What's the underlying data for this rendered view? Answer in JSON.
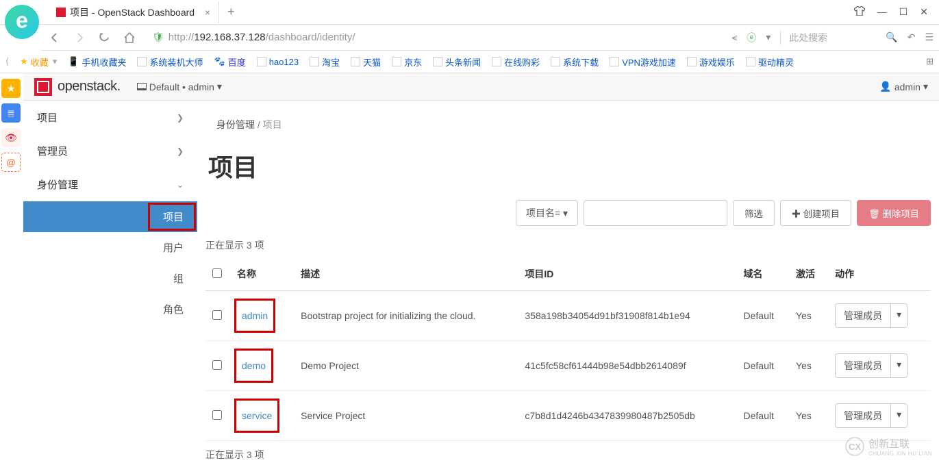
{
  "browser": {
    "tab_title": "项目 - OpenStack Dashboard",
    "url_proto": "http://",
    "url_host": "192.168.37.128",
    "url_path": "/dashboard/identity/",
    "search_placeholder": "此处搜索"
  },
  "bookmarks": {
    "fav": "收藏",
    "mobile": "手机收藏夹",
    "items": [
      "系统装机大师",
      "百度",
      "hao123",
      "淘宝",
      "天猫",
      "京东",
      "头条新闻",
      "在线购彩",
      "系统下载",
      "VPN游戏加速",
      "游戏娱乐",
      "驱动精灵"
    ]
  },
  "openstack": {
    "logo": "openstack.",
    "context": "Default • admin",
    "user": "admin"
  },
  "sidebar": {
    "items": [
      {
        "label": "项目",
        "expanded": false
      },
      {
        "label": "管理员",
        "expanded": false
      },
      {
        "label": "身份管理",
        "expanded": true
      }
    ],
    "subitems": [
      "项目",
      "用户",
      "组",
      "角色"
    ]
  },
  "breadcrumb": {
    "parent": "身份管理",
    "current": "项目"
  },
  "page": {
    "title": "项目"
  },
  "toolbar": {
    "filter_label": "项目名=",
    "filter_btn": "筛选",
    "create_btn": "创建项目",
    "delete_btn": "删除项目"
  },
  "table": {
    "count_text": "正在显示 3 项",
    "headers": {
      "name": "名称",
      "desc": "描述",
      "id": "项目ID",
      "domain": "域名",
      "active": "激活",
      "action": "动作"
    },
    "rows": [
      {
        "name": "admin",
        "desc": "Bootstrap project for initializing the cloud.",
        "id": "358a198b34054d91bf31908f814b1e94",
        "domain": "Default",
        "active": "Yes",
        "action": "管理成员"
      },
      {
        "name": "demo",
        "desc": "Demo Project",
        "id": "41c5fc58cf61444b98e54dbb2614089f",
        "domain": "Default",
        "active": "Yes",
        "action": "管理成员"
      },
      {
        "name": "service",
        "desc": "Service Project",
        "id": "c7b8d1d4246b4347839980487b2505db",
        "domain": "Default",
        "active": "Yes",
        "action": "管理成员"
      }
    ]
  },
  "watermark": {
    "text1": "创新互联",
    "text2": "CHUANG XIN HU LIAN"
  }
}
